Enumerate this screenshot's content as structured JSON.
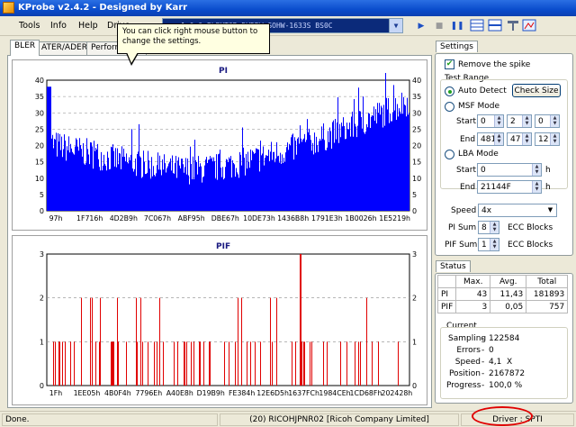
{
  "window": {
    "title": "KProbe v2.4.2 - Designed by Karr"
  },
  "menu": {
    "tools": "Tools",
    "info": "Info",
    "help": "Help",
    "drive": "Drive"
  },
  "drive_select": {
    "value": "1:0:0 PLEXTOR DVDRW SOHW-1633S BS0C"
  },
  "tooltip": {
    "line1": "You can click right mouse button to",
    "line2": "change the settings."
  },
  "tabs": [
    "BLER",
    "ATER/ADER",
    "Performance"
  ],
  "chart_data": [
    {
      "type": "bar",
      "title": "PI",
      "ylim": [
        0,
        40
      ],
      "y_ticks": [
        0,
        5,
        10,
        15,
        20,
        25,
        30,
        35,
        40
      ],
      "x_tick_labels": [
        "97h",
        "1F716h",
        "4D2B9h",
        "7C067h",
        "ABF95h",
        "DBE67h",
        "10DE73h",
        "1436B8h",
        "1791E3h",
        "1B0026h",
        "1E5219h"
      ],
      "series": [
        {
          "color": "#0000ff",
          "peak": 43,
          "average": 11.43,
          "total": 181893
        }
      ],
      "grid": true
    },
    {
      "type": "bar",
      "title": "PIF",
      "ylim": [
        0,
        3
      ],
      "y_ticks": [
        0,
        1,
        2,
        3
      ],
      "x_tick_labels": [
        "1Fh",
        "1EE05h",
        "4B0F4h",
        "7796Eh",
        "A40E8h",
        "D19B9h",
        "FE384h",
        "12E6D5h",
        "1637FCh",
        "1984CEh",
        "1CD68Fh",
        "202428h"
      ],
      "series": [
        {
          "color": "#e00000",
          "peak": 3,
          "average": 0.05,
          "total": 757
        }
      ],
      "grid": true
    }
  ],
  "settings": {
    "tab": "Settings",
    "remove_spike": "Remove the spike",
    "test_range": "Test Range",
    "auto_detect": "Auto Detect",
    "check_size": "Check Size",
    "msf_mode": "MSF Mode",
    "start": "Start",
    "end": "End",
    "msf_start": [
      "0",
      "2",
      "0"
    ],
    "msf_end": [
      "481",
      "47",
      "12"
    ],
    "lba_mode": "LBA Mode",
    "lba_start": "0",
    "lba_end": "21144F",
    "h": "h",
    "speed_label": "Speed",
    "speed_value": "4x",
    "pi_sum_label": "PI Sum",
    "pi_sum_value": "8",
    "pif_sum_label": "PIF Sum",
    "pif_sum_value": "1",
    "ecc_blocks": "ECC Blocks"
  },
  "status": {
    "tab": "Status",
    "headers": [
      "Max.",
      "Avg.",
      "Total"
    ],
    "rows": [
      {
        "name": "PI",
        "max": "43",
        "avg": "11,43",
        "total": "181893"
      },
      {
        "name": "PIF",
        "max": "3",
        "avg": "0,05",
        "total": "757"
      }
    ],
    "current": "Current",
    "sampling_label": "Sampling",
    "sampling_value": "122584",
    "errors_label": "Errors",
    "errors_value": "0",
    "speed_label": "Speed",
    "speed_value": "4,1",
    "speed_unit": "X",
    "position_label": "Position",
    "position_value": "2167872",
    "progress_label": "Progress",
    "progress_value": "100,0 %"
  },
  "statusbar": {
    "left": "Done.",
    "middle": "(20) RICOHJPNR02 [Ricoh Company Limited]",
    "driver": "Driver : SPTI"
  }
}
